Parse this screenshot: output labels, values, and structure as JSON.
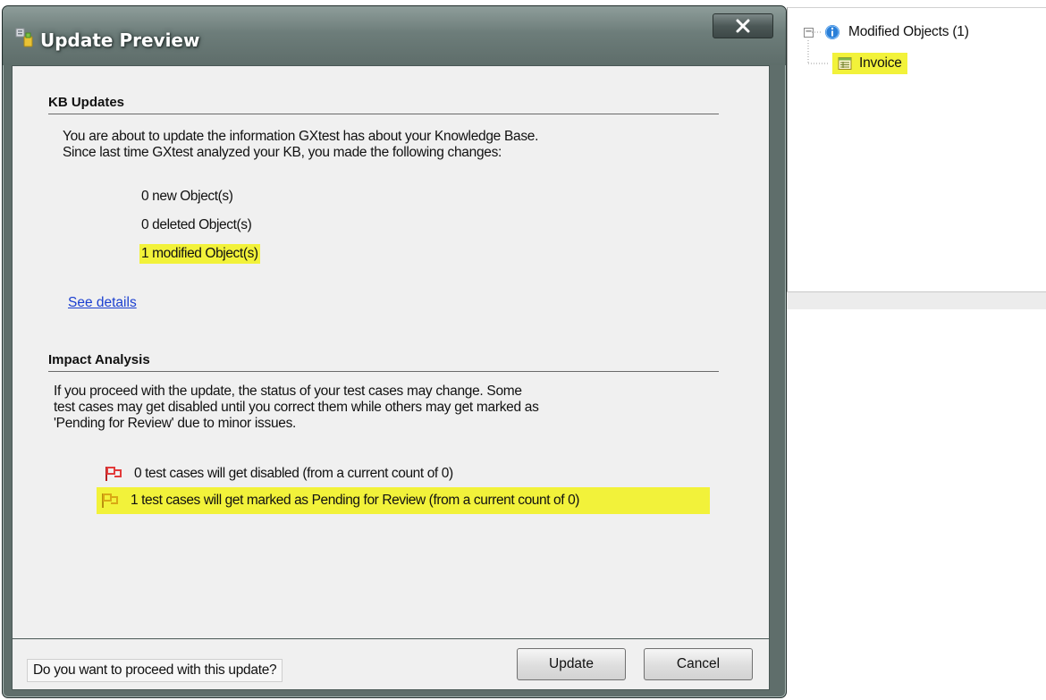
{
  "dialog": {
    "title": "Update Preview",
    "kb_section": {
      "heading": "KB Updates",
      "intro_line1": "You are about to update the information GXtest has about your Knowledge Base.",
      "intro_line2": "Since last time GXtest analyzed your KB, you made the following changes:",
      "new_objects": "0 new Object(s)",
      "deleted_objects": "0 deleted Object(s)",
      "modified_objects": "1 modified Object(s)",
      "see_details": "See details"
    },
    "impact_section": {
      "heading": "Impact Analysis",
      "line1": "If you proceed with the update, the status of your test cases may change. Some",
      "line2": "test cases may get disabled until you correct them while others may get marked as",
      "line3": "'Pending for Review' due to minor issues.",
      "items": [
        {
          "text": "0 test cases will get disabled (from a current count of 0)",
          "flag_color": "#e23a3a",
          "highlighted": false
        },
        {
          "text": "1 test cases will get marked as Pending for Review (from a current count of 0)",
          "flag_color": "#e8c11a",
          "highlighted": true
        }
      ]
    },
    "footer": {
      "question": "Do you want to proceed with this update?",
      "update_label": "Update",
      "cancel_label": "Cancel"
    }
  },
  "tree": {
    "root_label": "Modified Objects (1)",
    "root_expander": "−",
    "child_label": "Invoice"
  },
  "colors": {
    "highlight": "#f2f23a",
    "link": "#1b3fd0",
    "info_icon": "#2a7fd8"
  }
}
